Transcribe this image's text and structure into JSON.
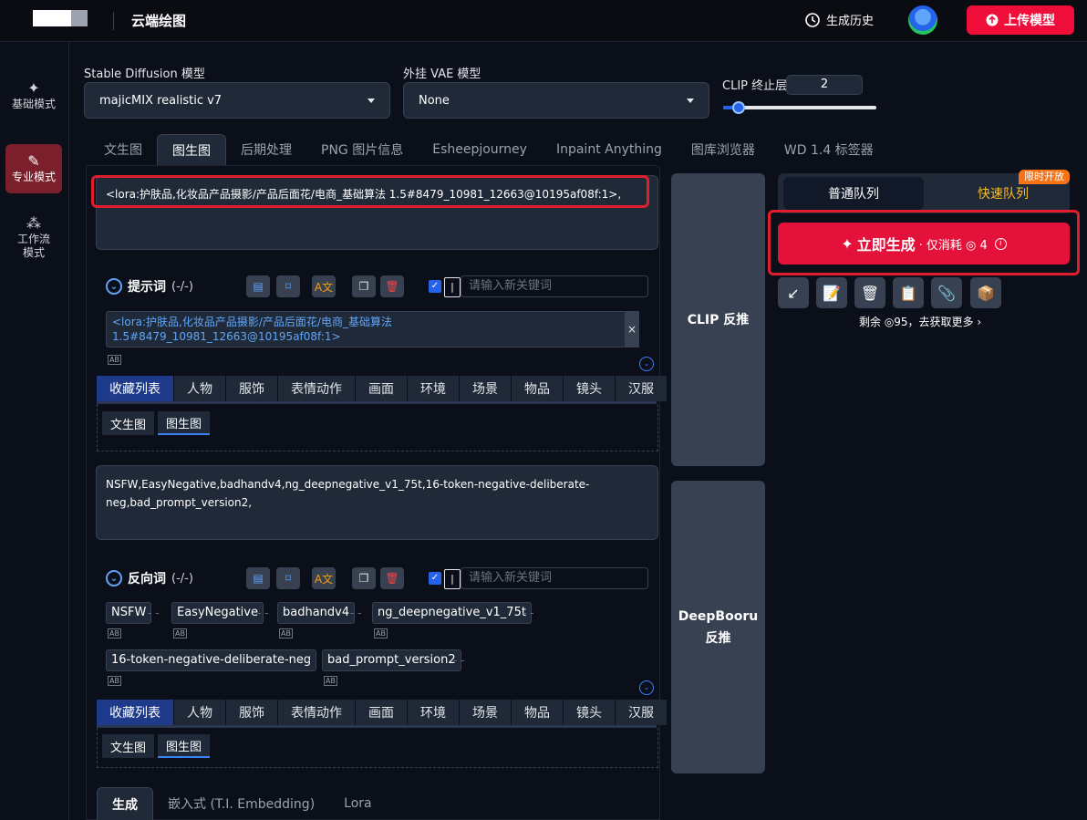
{
  "header": {
    "title": "云端绘图",
    "history": "生成历史",
    "upload": "上传模型"
  },
  "sidebar": {
    "items": [
      {
        "label": "基础模式",
        "icon": "sparkle-icon"
      },
      {
        "label": "专业模式",
        "icon": "brush-icon"
      },
      {
        "label": "工作流\n模式",
        "icon": "workflow-icon"
      }
    ]
  },
  "settings": {
    "sd_label": "Stable Diffusion 模型",
    "sd_value": "majicMIX realistic v7",
    "vae_label": "外挂 VAE 模型",
    "vae_value": "None",
    "clip_label": "CLIP 终止层数",
    "clip_value": "2",
    "clip_level_fraction": 0.1
  },
  "tabs": [
    "文生图",
    "图生图",
    "后期处理",
    "PNG 图片信息",
    "Esheepjourney",
    "Inpaint Anything",
    "图库浏览器",
    "WD 1.4 标签器"
  ],
  "prompt": {
    "text": "<lora:护肤品,化妆品产品摄影/产品后面花/电商_基础算法 1.5#8479_10981_12663@10195af08f:1>,",
    "title": "提示词",
    "count": "(-/-)",
    "keyword_placeholder": "请输入新关键词",
    "chip": "<lora:护肤品,化妆品产品摄影/产品后面花/电商_基础算法 1.5#8479_10981_12663@10195af08f:1>",
    "chip_close": "×"
  },
  "categories": [
    "收藏列表",
    "人物",
    "服饰",
    "表情动作",
    "画面",
    "环境",
    "场景",
    "物品",
    "镜头",
    "汉服"
  ],
  "subtabs": [
    "文生图",
    "图生图"
  ],
  "negative": {
    "text": "NSFW,EasyNegative,badhandv4,ng_deepnegative_v1_75t,16-token-negative-deliberate-neg,bad_prompt_version2,",
    "title": "反向词",
    "count": "(-/-)",
    "keyword_placeholder": "请输入新关键词",
    "chips": [
      "NSFW",
      "EasyNegative",
      "badhandv4",
      "ng_deepnegative_v1_75t",
      "16-token-negative-deliberate-neg",
      "bad_prompt_version2"
    ]
  },
  "actions": {
    "clip": "CLIP 反推",
    "deepbooru": "DeepBooru\n反推"
  },
  "queue": {
    "normal": "普通队列",
    "fast": "快速队列",
    "badge": "限时开放"
  },
  "generate": {
    "label": "立即生成",
    "sub": "· 仅消耗 ◎ 4"
  },
  "remain": "剩余 ◎95，去获取更多 ›",
  "bottom_tabs": [
    "生成",
    "嵌入式 (T.I. Embedding)",
    "Lora"
  ]
}
